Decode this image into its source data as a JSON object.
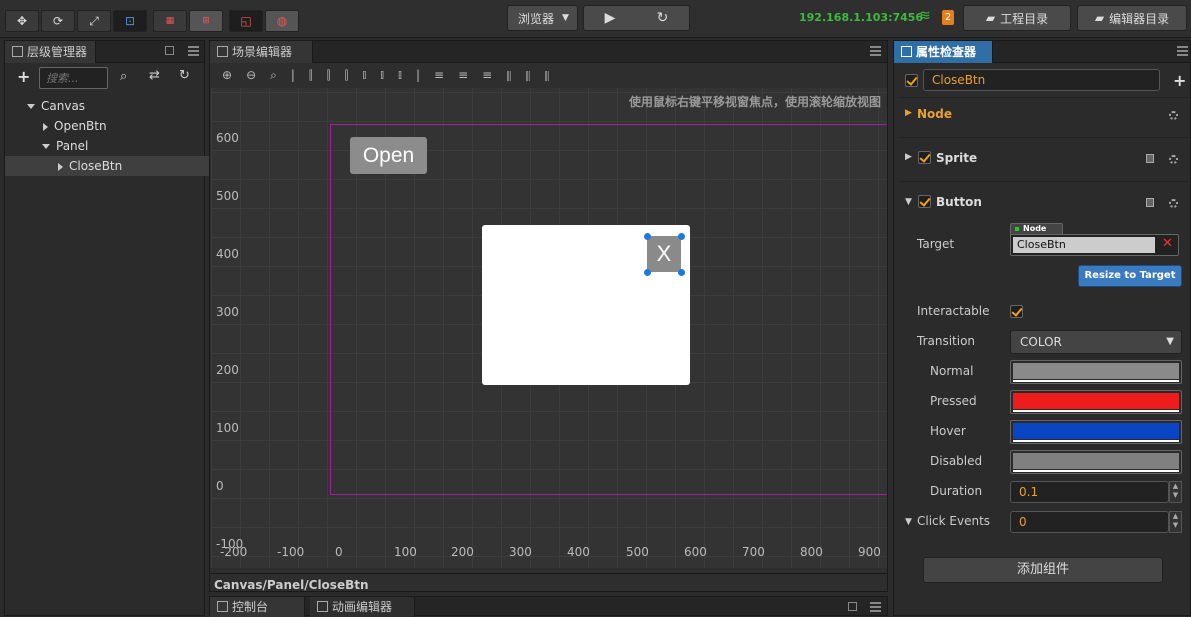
{
  "toolbar": {
    "tools": [
      "move-tool",
      "rotate-tool",
      "scale-tool",
      "rect-tool",
      "local-global",
      "pivot-center",
      "scene-2d",
      "scene-3d"
    ],
    "preview_select": "浏览器",
    "play_icon": "play-icon",
    "refresh_icon": "refresh-icon",
    "ip": "192.168.1.103:7456",
    "wifi_icon": "wifi-icon",
    "badge_count": "2",
    "project_dir": "工程目录",
    "editor_dir": "编辑器目录"
  },
  "hierarchy": {
    "tab": "层级管理器",
    "search_placeholder": "搜索...",
    "nodes": [
      {
        "label": "Canvas"
      },
      {
        "label": "OpenBtn"
      },
      {
        "label": "Panel"
      },
      {
        "label": "CloseBtn"
      }
    ]
  },
  "scene": {
    "tab": "场景编辑器",
    "hint": "使用鼠标右键平移视窗焦点，使用滚轮缩放视图",
    "y_ticks": [
      "600",
      "500",
      "400",
      "300",
      "200",
      "100",
      "0",
      "-100"
    ],
    "x_ticks": [
      "-200",
      "-100",
      "0",
      "100",
      "200",
      "300",
      "400",
      "500",
      "600",
      "700",
      "800",
      "900"
    ],
    "open_button": "Open",
    "close_button": "X",
    "breadcrumb": "Canvas/Panel/CloseBtn"
  },
  "bottom_tabs": {
    "console": "控制台",
    "animation": "动画编辑器"
  },
  "inspector": {
    "tab": "属性检查器",
    "node_name": "CloseBtn",
    "sections": {
      "node": "Node",
      "sprite": "Sprite",
      "button": "Button"
    },
    "target_label": "Target",
    "target_tag": "Node",
    "target_value": "CloseBtn",
    "resize_button": "Resize to Target",
    "interactable_label": "Interactable",
    "transition_label": "Transition",
    "transition_value": "COLOR",
    "normal_label": "Normal",
    "normal_color": "#8a8a8a",
    "pressed_label": "Pressed",
    "pressed_color": "#ee1c1c",
    "hover_label": "Hover",
    "hover_color": "#0a46c4",
    "disabled_label": "Disabled",
    "disabled_color": "#808080",
    "duration_label": "Duration",
    "duration_value": "0.1",
    "click_events_label": "Click Events",
    "click_events_value": "0",
    "add_component": "添加组件"
  }
}
